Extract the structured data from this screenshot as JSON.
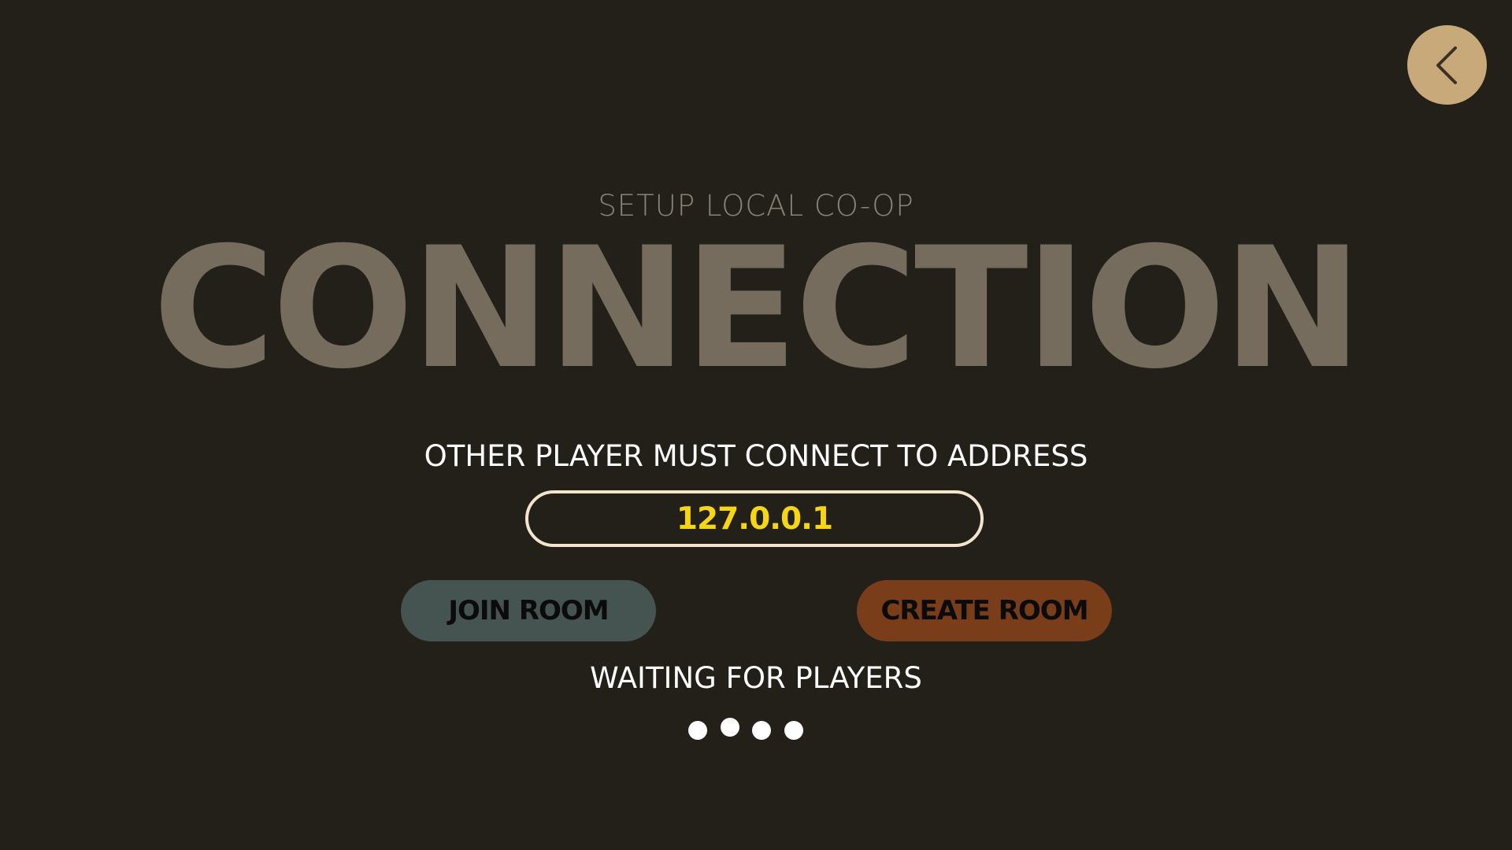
{
  "header": {
    "back_icon": "chevron-left-icon"
  },
  "title": {
    "subtitle": "SETUP LOCAL CO-OP",
    "heading": "CONNECTION"
  },
  "connection": {
    "instruction": "OTHER PLAYER MUST CONNECT TO ADDRESS",
    "address": "127.0.0.1"
  },
  "actions": {
    "join_label": "JOIN ROOM",
    "create_label": "CREATE ROOM"
  },
  "status": {
    "text": "WAITING FOR PLAYERS",
    "indicator_count": 4
  },
  "colors": {
    "background": "#231f19",
    "back_button": "#c7a97a",
    "title": "#756c5d",
    "address_text": "#f6d416",
    "address_border": "#f3e4cb",
    "join_button": "#465451",
    "create_button": "#793e19"
  }
}
